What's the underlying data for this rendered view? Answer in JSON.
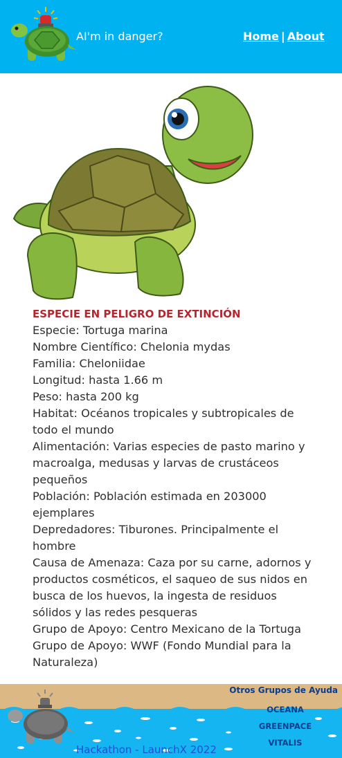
{
  "header": {
    "title": "AI'm in danger?",
    "nav": {
      "home": "Home",
      "separator": "|",
      "about": "About"
    }
  },
  "species": {
    "alert": "ESPECIE EN PELIGRO DE EXTINCIÓN",
    "lines": [
      "Especie: Tortuga marina",
      "Nombre Científico: Chelonia mydas",
      "Familia: Cheloniidae",
      "Longitud: hasta 1.66 m",
      "Peso: hasta 200 kg",
      "Habitat: Océanos tropicales y subtropicales de todo el mundo",
      "Alimentación: Varias especies de pasto marino y macroalga, medusas y larvas de crustáceos pequeños",
      "Población: Población estimada en 203000 ejemplares",
      "Depredadores: Tiburones. Principalmente el hombre",
      "Causa de Amenaza: Caza por su carne, adornos y productos cosméticos, el saqueo de sus nidos en busca de los huevos, la ingesta de residuos sólidos y las redes pesqueras",
      "Grupo de Apoyo: Centro Mexicano de la Tortuga",
      "Grupo de Apoyo: WWF (Fondo Mundial para la Naturaleza)"
    ]
  },
  "footer": {
    "help_title": "Otros Grupos de Ayuda",
    "links": [
      "OCEANA",
      "GREENPACE",
      "VITALIS"
    ],
    "credit": "Hackathon - LaunchX 2022"
  },
  "colors": {
    "header_bg": "#00b2f0",
    "alert": "#b3262e",
    "sand": "#dcb885",
    "water": "#14b5f0"
  },
  "icons": {
    "logo": "turtle-with-siren-icon",
    "hero": "cartoon-turtle-illustration",
    "footer": "gray-turtle-with-siren-icon"
  }
}
